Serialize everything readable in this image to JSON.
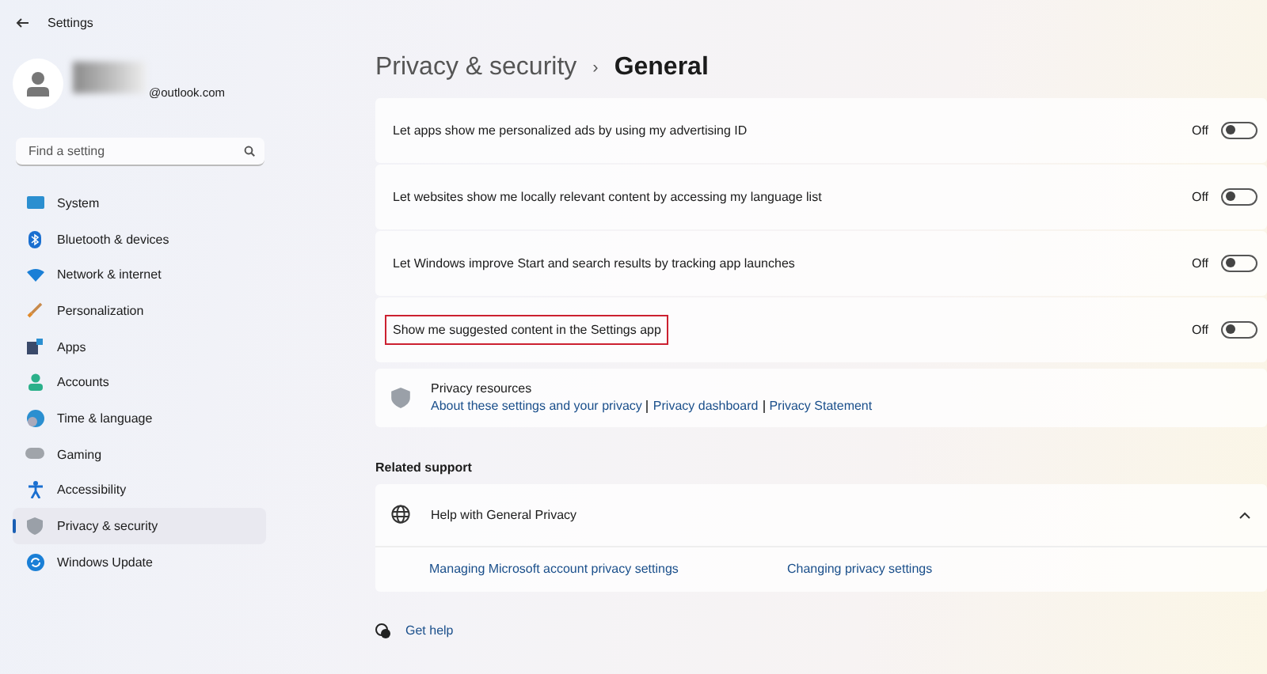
{
  "window": {
    "title": "Settings"
  },
  "account": {
    "email": "@outlook.com"
  },
  "search": {
    "placeholder": "Find a setting"
  },
  "sidebar": {
    "items": [
      {
        "label": "System",
        "selected": false
      },
      {
        "label": "Bluetooth & devices",
        "selected": false
      },
      {
        "label": "Network & internet",
        "selected": false
      },
      {
        "label": "Personalization",
        "selected": false
      },
      {
        "label": "Apps",
        "selected": false
      },
      {
        "label": "Accounts",
        "selected": false
      },
      {
        "label": "Time & language",
        "selected": false
      },
      {
        "label": "Gaming",
        "selected": false
      },
      {
        "label": "Accessibility",
        "selected": false
      },
      {
        "label": "Privacy & security",
        "selected": true
      },
      {
        "label": "Windows Update",
        "selected": false
      }
    ]
  },
  "breadcrumb": {
    "parent": "Privacy & security",
    "separator": "›",
    "current": "General"
  },
  "settings": [
    {
      "label": "Let apps show me personalized ads by using my advertising ID",
      "state_text": "Off",
      "on": false,
      "highlighted": false
    },
    {
      "label": "Let websites show me locally relevant content by accessing my language list",
      "state_text": "Off",
      "on": false,
      "highlighted": false
    },
    {
      "label": "Let Windows improve Start and search results by tracking app launches",
      "state_text": "Off",
      "on": false,
      "highlighted": false
    },
    {
      "label": "Show me suggested content in the Settings app",
      "state_text": "Off",
      "on": false,
      "highlighted": true
    }
  ],
  "privacy_resources": {
    "title": "Privacy resources",
    "links": [
      "About these settings and your privacy",
      "Privacy dashboard",
      "Privacy Statement"
    ]
  },
  "related_support": {
    "heading": "Related support",
    "title": "Help with General Privacy",
    "expanded": true,
    "links": [
      "Managing Microsoft account privacy settings",
      "Changing privacy settings"
    ]
  },
  "get_help": "Get help"
}
